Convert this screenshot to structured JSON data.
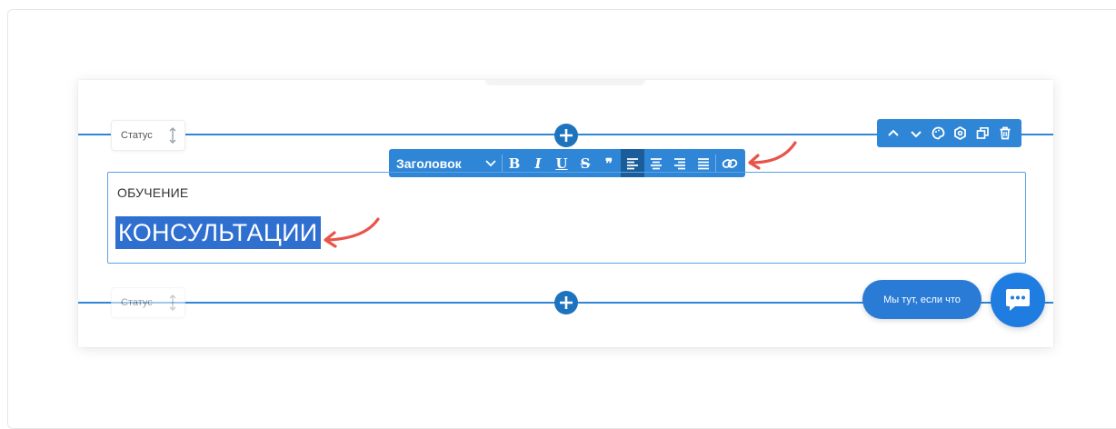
{
  "rows": [
    {
      "status_label": "Статус"
    },
    {
      "status_label": "Статус"
    }
  ],
  "block_toolbar": {
    "icons": [
      "chevron-up-icon",
      "chevron-down-icon",
      "palette-icon",
      "settings-icon",
      "duplicate-icon",
      "trash-icon"
    ]
  },
  "format_toolbar": {
    "style_select": "Заголовок",
    "buttons": [
      {
        "icon": "bold-icon",
        "glyph": "B"
      },
      {
        "icon": "italic-icon",
        "glyph": "I"
      },
      {
        "icon": "underline-icon",
        "glyph": "U"
      },
      {
        "icon": "strikethrough-icon",
        "glyph": "S"
      },
      {
        "icon": "quote-icon",
        "glyph": "❞"
      },
      {
        "icon": "align-left-icon",
        "active": true
      },
      {
        "icon": "align-center-icon"
      },
      {
        "icon": "align-right-icon"
      },
      {
        "icon": "align-justify-icon"
      },
      {
        "icon": "link-icon"
      }
    ]
  },
  "content": {
    "subtitle": "ОБУЧЕНИЕ",
    "headline": "КОНСУЛЬТАЦИИ"
  },
  "chat": {
    "pill_text": "Мы тут, если что"
  },
  "colors": {
    "accent": "#2f86d6",
    "selection": "#2f6fcf",
    "annotation_arrow": "#e8544a"
  }
}
